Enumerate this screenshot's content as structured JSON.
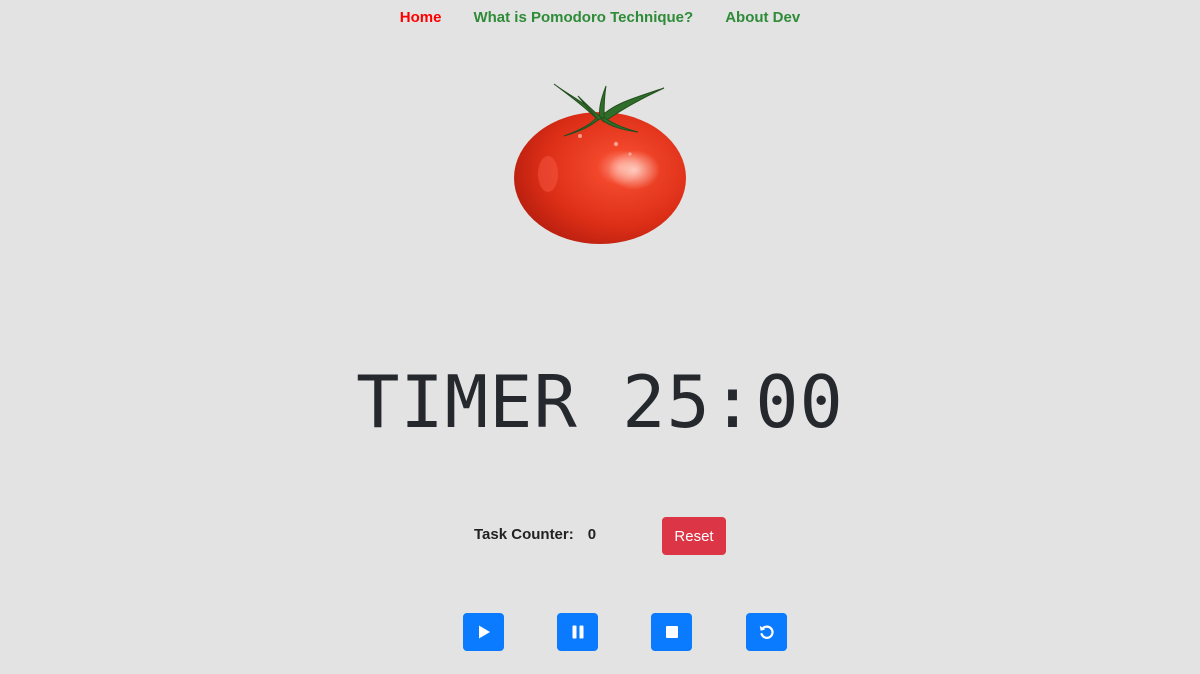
{
  "nav": {
    "home": "Home",
    "pomodoro": "What is Pomodoro Technique?",
    "about": "About Dev"
  },
  "image": {
    "icon": "tomato-image"
  },
  "timer": {
    "label": "TIMER",
    "value": "25:00",
    "display": "TIMER 25:00"
  },
  "task_counter": {
    "label": "Task Counter:",
    "value": "0"
  },
  "reset_label": "Reset",
  "controls": [
    {
      "icon": "play-icon"
    },
    {
      "icon": "pause-icon"
    },
    {
      "icon": "stop-icon"
    },
    {
      "icon": "restart-icon"
    }
  ],
  "colors": {
    "background": "#e3e3e3",
    "nav_active": "#ff0000",
    "nav_link": "#2e8b37",
    "reset": "#dc3545",
    "control": "#0a7bfe"
  }
}
